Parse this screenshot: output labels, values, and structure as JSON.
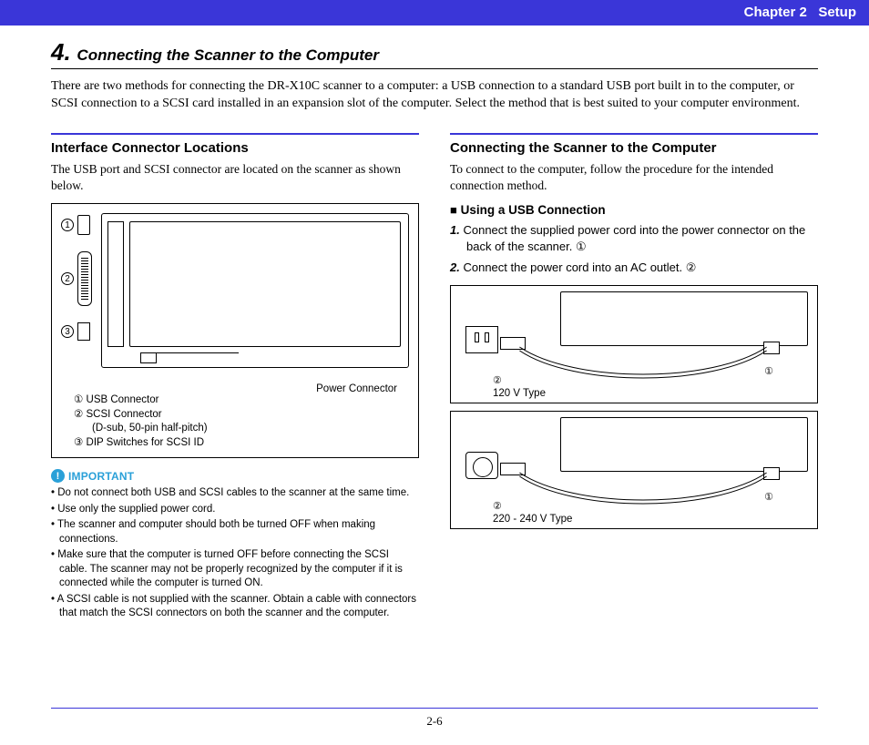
{
  "header": {
    "chapter": "Chapter 2",
    "title": "Setup"
  },
  "section": {
    "number": "4.",
    "title": "Connecting the Scanner to the Computer"
  },
  "intro": "There are two methods for connecting the DR-X10C scanner to a computer: a USB connection to a standard USB port built in to the computer, or SCSI connection to a SCSI card installed in an expansion slot of the computer. Select the method that is best suited to your computer environment.",
  "left": {
    "heading": "Interface Connector Locations",
    "text": "The USB port and SCSI connector are located on the scanner as shown below.",
    "figure": {
      "power_label": "Power Connector",
      "legend": [
        {
          "n": "①",
          "label": "USB Connector"
        },
        {
          "n": "②",
          "label": "SCSI Connector",
          "sub": "(D-sub, 50-pin half-pitch)"
        },
        {
          "n": "③",
          "label": "DIP Switches for SCSI ID"
        }
      ]
    },
    "important": {
      "label": "IMPORTANT",
      "items": [
        "Do not connect both USB and SCSI cables to the scanner at the same time.",
        "Use only the supplied power cord.",
        "The scanner and computer should both be turned OFF when making connections.",
        "Make sure that the computer is turned OFF before connecting the SCSI cable. The scanner may not be properly recognized by the computer if it is connected while the computer is turned ON.",
        "A SCSI cable is not supplied with the scanner. Obtain a cable with connectors that match the SCSI connectors on both the scanner and the computer."
      ]
    }
  },
  "right": {
    "heading": "Connecting the Scanner to the Computer",
    "text": "To connect to the computer, follow the procedure for the intended connection method.",
    "sub_heading_marker": "■",
    "sub_heading": "Using a USB Connection",
    "steps": [
      {
        "n": "1.",
        "text": "Connect the supplied power cord into the power connector on the back of the scanner. ①"
      },
      {
        "n": "2.",
        "text": "Connect the power cord into an AC outlet. ②"
      }
    ],
    "fig1": {
      "left_marker": "②",
      "right_marker": "①",
      "type": "120 V Type"
    },
    "fig2": {
      "left_marker": "②",
      "right_marker": "①",
      "type": "220 - 240 V Type"
    }
  },
  "page_number": "2-6"
}
